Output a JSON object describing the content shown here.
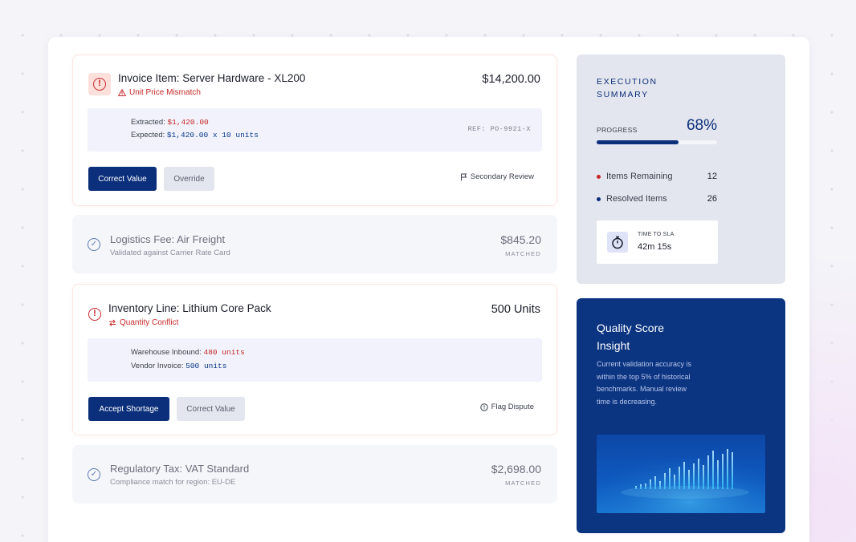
{
  "items": [
    {
      "title": "Invoice Item: Server Hardware - XL200",
      "issue": "Unit Price Mismatch",
      "amount": "$14,200.00",
      "extracted_label": "Extracted:",
      "extracted_value": "$1,420.00",
      "expected_label": "Expected:",
      "expected_value": "$1,420.00 x 10 units",
      "ref": "REF: PO-9921-X",
      "primary_action": "Correct Value",
      "secondary_action": "Override",
      "link_action": "Secondary Review"
    },
    {
      "title": "Logistics Fee: Air Freight",
      "subtitle": "Validated against Carrier Rate Card",
      "amount": "$845.20",
      "status": "MATCHED"
    },
    {
      "title": "Inventory Line: Lithium Core Pack",
      "issue": "Quantity Conflict",
      "amount": "500 Units",
      "line1_label": "Warehouse Inbound:",
      "line1_value": "480 units",
      "line2_label": "Vendor Invoice:",
      "line2_value": "500 units",
      "primary_action": "Accept Shortage",
      "secondary_action": "Correct Value",
      "link_action": "Flag Dispute"
    },
    {
      "title": "Regulatory Tax: VAT Standard",
      "subtitle": "Compliance match for region: EU-DE",
      "amount": "$2,698.00",
      "status": "MATCHED"
    }
  ],
  "summary": {
    "title": "EXECUTION SUMMARY",
    "progress_label": "PROGRESS",
    "progress_value": "68%",
    "progress_fraction": 0.68,
    "remaining_label": "Items Remaining",
    "remaining_value": "12",
    "resolved_label": "Resolved Items",
    "resolved_value": "26",
    "sla_label": "TIME TO SLA",
    "sla_value": "42m 15s"
  },
  "insight": {
    "title": "Quality Score Insight",
    "body": "Current validation accuracy is within the top 5% of historical benchmarks. Manual review time is decreasing."
  },
  "colors": {
    "navy": "#0b2f7a",
    "alert_red": "#c62828",
    "remaining_dot": "#c62828",
    "resolved_dot": "#0b2f7a"
  }
}
